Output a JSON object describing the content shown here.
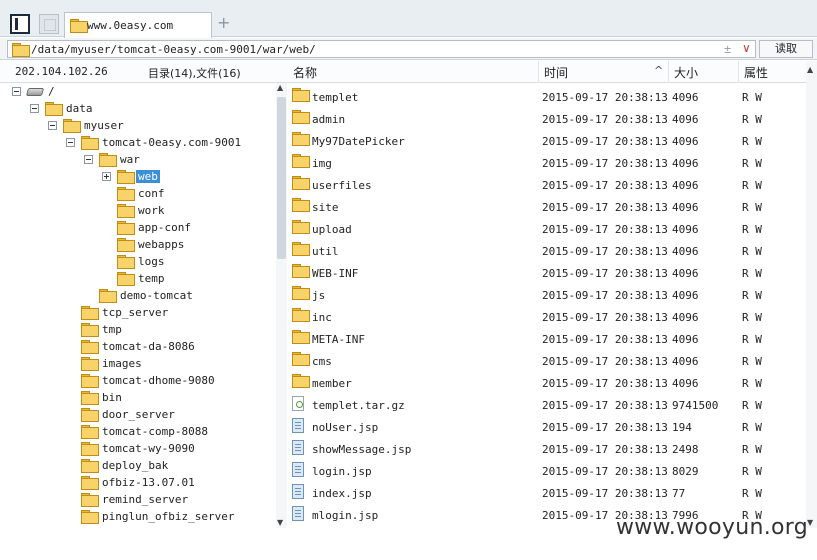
{
  "tab": {
    "title": "www.0easy.com",
    "add": "+"
  },
  "address": {
    "path": "/data/myuser/tomcat-0easy.com-9001/war/web/",
    "read_label": "读取",
    "icon_a": "±",
    "icon_b": "∨"
  },
  "left_panel": {
    "ip": "202.104.102.26",
    "counts": "目录(14),文件(16)"
  },
  "columns": {
    "name": "名称",
    "time": "时间",
    "size": "大小",
    "attr": "属性",
    "sort": "^"
  },
  "tree": [
    {
      "label": "/",
      "depth": 0,
      "toggle": "minus",
      "icon": "drive"
    },
    {
      "label": "data",
      "depth": 1,
      "toggle": "minus",
      "icon": "folder"
    },
    {
      "label": "myuser",
      "depth": 2,
      "toggle": "minus",
      "icon": "folder"
    },
    {
      "label": "tomcat-0easy.com-9001",
      "depth": 3,
      "toggle": "minus",
      "icon": "folder"
    },
    {
      "label": "war",
      "depth": 4,
      "toggle": "minus",
      "icon": "folder"
    },
    {
      "label": "web",
      "depth": 5,
      "toggle": "plus",
      "icon": "folder",
      "selected": true
    },
    {
      "label": "conf",
      "depth": 5,
      "toggle": "",
      "icon": "folder"
    },
    {
      "label": "work",
      "depth": 5,
      "toggle": "",
      "icon": "folder"
    },
    {
      "label": "app-conf",
      "depth": 5,
      "toggle": "",
      "icon": "folder"
    },
    {
      "label": "webapps",
      "depth": 5,
      "toggle": "",
      "icon": "folder"
    },
    {
      "label": "logs",
      "depth": 5,
      "toggle": "",
      "icon": "folder"
    },
    {
      "label": "temp",
      "depth": 5,
      "toggle": "",
      "icon": "folder"
    },
    {
      "label": "demo-tomcat",
      "depth": 4,
      "toggle": "",
      "icon": "folder"
    },
    {
      "label": "tcp_server",
      "depth": 3,
      "toggle": "",
      "icon": "folder"
    },
    {
      "label": "tmp",
      "depth": 3,
      "toggle": "",
      "icon": "folder"
    },
    {
      "label": "tomcat-da-8086",
      "depth": 3,
      "toggle": "",
      "icon": "folder"
    },
    {
      "label": "images",
      "depth": 3,
      "toggle": "",
      "icon": "folder"
    },
    {
      "label": "tomcat-dhome-9080",
      "depth": 3,
      "toggle": "",
      "icon": "folder"
    },
    {
      "label": "bin",
      "depth": 3,
      "toggle": "",
      "icon": "folder"
    },
    {
      "label": "door_server",
      "depth": 3,
      "toggle": "",
      "icon": "folder"
    },
    {
      "label": "tomcat-comp-8088",
      "depth": 3,
      "toggle": "",
      "icon": "folder"
    },
    {
      "label": "tomcat-wy-9090",
      "depth": 3,
      "toggle": "",
      "icon": "folder"
    },
    {
      "label": "deploy_bak",
      "depth": 3,
      "toggle": "",
      "icon": "folder"
    },
    {
      "label": "ofbiz-13.07.01",
      "depth": 3,
      "toggle": "",
      "icon": "folder"
    },
    {
      "label": "remind_server",
      "depth": 3,
      "toggle": "",
      "icon": "folder"
    },
    {
      "label": "pinglun_ofbiz_server",
      "depth": 3,
      "toggle": "",
      "icon": "folder"
    }
  ],
  "files": [
    {
      "name": "templet",
      "time": "2015-09-17 20:38:13",
      "size": "4096",
      "perm": "R W",
      "icon": "folder"
    },
    {
      "name": "admin",
      "time": "2015-09-17 20:38:13",
      "size": "4096",
      "perm": "R W",
      "icon": "folder"
    },
    {
      "name": "My97DatePicker",
      "time": "2015-09-17 20:38:13",
      "size": "4096",
      "perm": "R W",
      "icon": "folder"
    },
    {
      "name": "img",
      "time": "2015-09-17 20:38:13",
      "size": "4096",
      "perm": "R W",
      "icon": "folder"
    },
    {
      "name": "userfiles",
      "time": "2015-09-17 20:38:13",
      "size": "4096",
      "perm": "R W",
      "icon": "folder"
    },
    {
      "name": "site",
      "time": "2015-09-17 20:38:13",
      "size": "4096",
      "perm": "R W",
      "icon": "folder"
    },
    {
      "name": "upload",
      "time": "2015-09-17 20:38:13",
      "size": "4096",
      "perm": "R W",
      "icon": "folder"
    },
    {
      "name": "util",
      "time": "2015-09-17 20:38:13",
      "size": "4096",
      "perm": "R W",
      "icon": "folder"
    },
    {
      "name": "WEB-INF",
      "time": "2015-09-17 20:38:13",
      "size": "4096",
      "perm": "R W",
      "icon": "folder"
    },
    {
      "name": "js",
      "time": "2015-09-17 20:38:13",
      "size": "4096",
      "perm": "R W",
      "icon": "folder"
    },
    {
      "name": "inc",
      "time": "2015-09-17 20:38:13",
      "size": "4096",
      "perm": "R W",
      "icon": "folder"
    },
    {
      "name": "META-INF",
      "time": "2015-09-17 20:38:13",
      "size": "4096",
      "perm": "R W",
      "icon": "folder"
    },
    {
      "name": "cms",
      "time": "2015-09-17 20:38:13",
      "size": "4096",
      "perm": "R W",
      "icon": "folder"
    },
    {
      "name": "member",
      "time": "2015-09-17 20:38:13",
      "size": "4096",
      "perm": "R W",
      "icon": "folder"
    },
    {
      "name": "templet.tar.gz",
      "time": "2015-09-17 20:38:13",
      "size": "9741500",
      "perm": "R W",
      "icon": "file-gz"
    },
    {
      "name": "noUser.jsp",
      "time": "2015-09-17 20:38:13",
      "size": "194",
      "perm": "R W",
      "icon": "file-jsp"
    },
    {
      "name": "showMessage.jsp",
      "time": "2015-09-17 20:38:13",
      "size": "2498",
      "perm": "R W",
      "icon": "file-jsp"
    },
    {
      "name": "login.jsp",
      "time": "2015-09-17 20:38:13",
      "size": "8029",
      "perm": "R W",
      "icon": "file-jsp"
    },
    {
      "name": "index.jsp",
      "time": "2015-09-17 20:38:13",
      "size": "77",
      "perm": "R W",
      "icon": "file-jsp"
    },
    {
      "name": "mlogin.jsp",
      "time": "2015-09-17 20:38:13",
      "size": "7996",
      "perm": "R W",
      "icon": "file-jsp"
    }
  ],
  "watermark": "www.wooyun.org"
}
